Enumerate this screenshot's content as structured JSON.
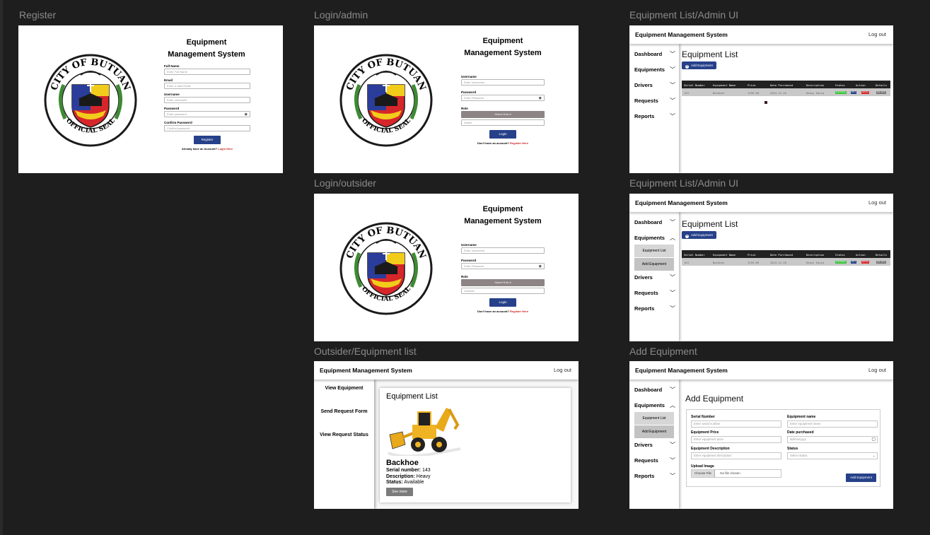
{
  "frames": {
    "register": "Register",
    "login_admin": "Login/admin",
    "login_outsider": "Login/outsider",
    "outsider_list": "Outsider/Equipment list",
    "admin_list_1": "Equipment List/Admin UI",
    "admin_list_2": "Equipment List/Admin UI",
    "add_equipment": "Add Equipment"
  },
  "seal": {
    "top_text": "CITY OF BUTUAN",
    "bottom_text": "OFFICIAL SEAL",
    "colors": {
      "ring": "#1a1a1a",
      "red": "#d7262a",
      "blue": "#2b3d9a",
      "yellow": "#f2cc1b",
      "leaf": "#3d8a32"
    }
  },
  "register": {
    "title": "Equipment Management System",
    "full_name_label": "Full Name",
    "full_name_placeholder": "Enter Full Name",
    "email_label": "Email",
    "email_placeholder": "Enter a valid Email",
    "username_label": "Username",
    "username_placeholder": "Enter username",
    "password_label": "Password",
    "password_placeholder": "Enter password",
    "confirm_label": "Confirm Password",
    "confirm_placeholder": "Confirm password",
    "button": "Register",
    "footer": "Already have an Account?",
    "footer_link": "Login Here"
  },
  "login_admin": {
    "title": "Equipment Management System",
    "username_label": "Username",
    "username_placeholder": "Enter Username",
    "password_label": "Password",
    "password_placeholder": "Enter Password",
    "role_label": "Role",
    "role_select": "Select Role ▾",
    "role_value": "Admin",
    "button": "Login",
    "footer": "Don't have an account?",
    "footer_link": "Register Here"
  },
  "login_outsider": {
    "title": "Equipment Management System",
    "username_label": "Username",
    "username_placeholder": "Enter Username",
    "password_label": "Password",
    "password_placeholder": "Enter Password",
    "role_label": "Role",
    "role_select": "Select Role ▾",
    "role_value": "Outsider",
    "button": "Login",
    "footer": "Don't have an account?",
    "footer_link": "Register Here"
  },
  "outsider": {
    "app_title": "Equipment Management System",
    "logout": "Log out",
    "nav": [
      "View Equipment",
      "Send Request Form",
      "View Request Status"
    ],
    "card_title": "Equipment List",
    "item_name": "Backhoe",
    "serial_label": "Serial number:",
    "serial_value": "143",
    "desc_label": "Description:",
    "desc_value": "Heavy",
    "status_label": "Status:",
    "status_value": "Available",
    "see_more": "See more"
  },
  "admin": {
    "app_title": "Equipment Management System",
    "logout": "Log out",
    "nav": [
      "Dashboard",
      "Equipments",
      "Drivers",
      "Requests",
      "Reports"
    ],
    "sub_nav": [
      "Equipment List",
      "Add Equipment"
    ],
    "page_title": "Equipment List",
    "add_button": "Add Equipment",
    "columns": [
      "Serial Number",
      "Equipment Name",
      "Price",
      "Date Purchased",
      "Description",
      "Status",
      "Action",
      "Details"
    ],
    "row": [
      "143",
      "Backhoe",
      "1299.00",
      "2024-12-16",
      "Heavy Equip",
      "Available",
      "Edit",
      "Delete",
      "See more"
    ]
  },
  "add_form": {
    "page_title": "Add Equipment",
    "serial_label": "Serial Number",
    "serial_placeholder": "Enter serial number",
    "name_label": "Equipment name",
    "name_placeholder": "Enter equipment name",
    "price_label": "Equipment Price",
    "price_placeholder": "Enter equipment price",
    "date_label": "Date purchased",
    "date_placeholder": "dd/mm/yyyy",
    "desc_label": "Equipment Description",
    "desc_placeholder": "Enter equipment description",
    "status_label": "Status",
    "status_placeholder": "Select status",
    "upload_label": "Upload Image",
    "choose_file": "Choose File",
    "no_file": "No file chosen",
    "submit": "Add Equipment"
  }
}
